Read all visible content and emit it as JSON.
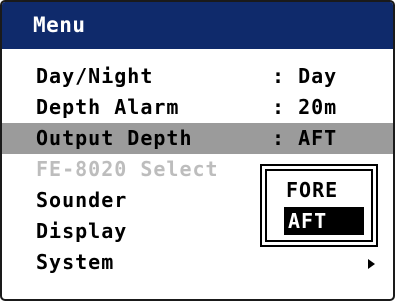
{
  "menu": {
    "title": "Menu",
    "items": [
      {
        "label": "Day/Night",
        "value": ": Day"
      },
      {
        "label": "Depth Alarm",
        "value": ": 20m"
      },
      {
        "label": "Output Depth",
        "value": ": AFT"
      },
      {
        "label": "FE-8020 Select",
        "value": ""
      },
      {
        "label": "Sounder",
        "value": ""
      },
      {
        "label": "Display",
        "value": ""
      },
      {
        "label": "System",
        "value": "",
        "submenu_icon": "right-triangle-icon"
      }
    ]
  },
  "popup": {
    "options": [
      "FORE",
      "AFT"
    ],
    "selected": "AFT"
  },
  "colors": {
    "title_bar": "#0f2a6b",
    "selected_row": "#9b9b9b",
    "disabled_text": "#bdbdbd"
  }
}
